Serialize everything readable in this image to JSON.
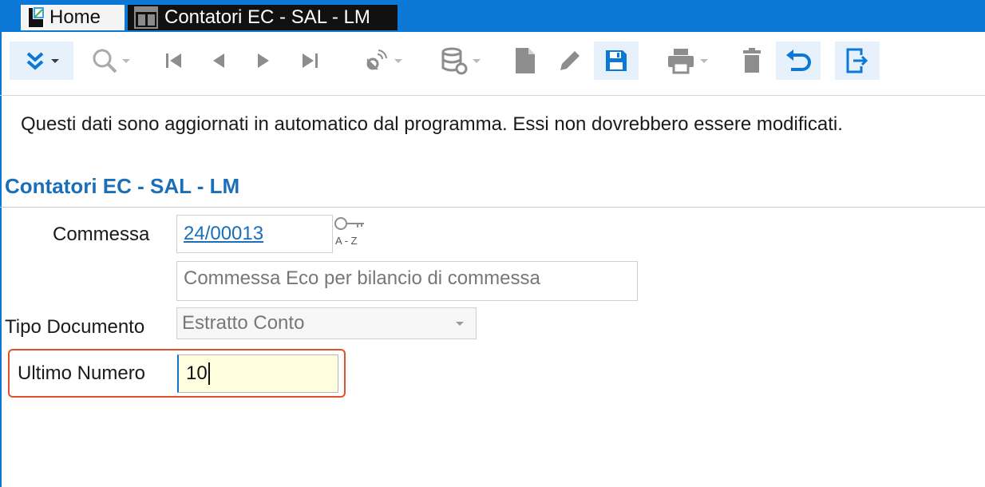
{
  "tabs": {
    "home_label": "Home",
    "active_label": "Contatori EC - SAL - LM"
  },
  "toolbar": {
    "icons": [
      "expand-icon",
      "search-icon",
      "first-record-icon",
      "previous-record-icon",
      "next-record-icon",
      "last-record-icon",
      "satellite-icon",
      "database-refresh-icon",
      "new-document-icon",
      "edit-icon",
      "save-icon",
      "print-icon",
      "delete-icon",
      "undo-icon",
      "exit-icon"
    ]
  },
  "info_message": "Questi dati sono aggiornati in automatico dal programma. Essi non dovrebbero essere modificati.",
  "section_title": "Contatori EC - SAL - LM",
  "form": {
    "commessa": {
      "label": "Commessa",
      "value": "24/00013",
      "description": "Commessa Eco per bilancio di commessa",
      "lookup_icon_text": "A - Z"
    },
    "tipo_documento": {
      "label": "Tipo Documento",
      "value": "Estratto Conto"
    },
    "ultimo_numero": {
      "label": "Ultimo Numero",
      "value": "10"
    }
  },
  "colors": {
    "accent": "#0a78d4",
    "title": "#1a6fb8",
    "highlight": "#e0502c",
    "input_bg": "#ffffe0"
  }
}
